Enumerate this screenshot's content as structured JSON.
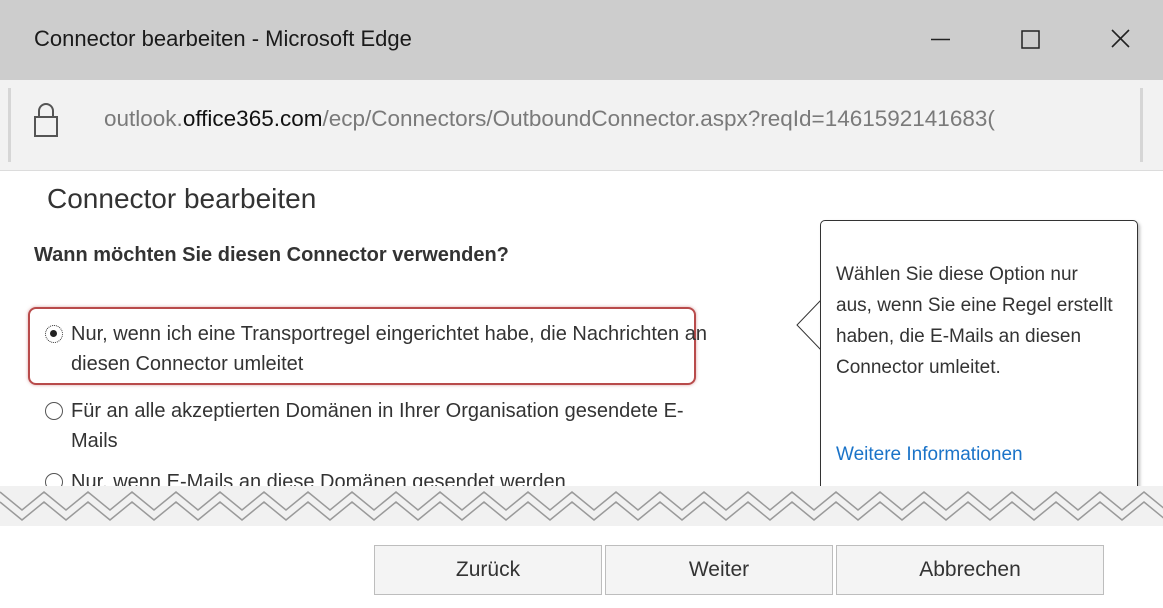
{
  "window": {
    "title": "Connector bearbeiten - Microsoft Edge"
  },
  "address_bar": {
    "url_prefix": "outlook.",
    "url_domain": "office365.com",
    "url_path": "/ecp/Connectors/OutboundConnector.aspx?reqId=1461592141683("
  },
  "page": {
    "title": "Connector bearbeiten",
    "question": "Wann möchten Sie diesen Connector verwenden?"
  },
  "options": [
    {
      "label": "Nur, wenn ich eine Transportregel eingerichtet habe, die Nachrichten an diesen Connector umleitet",
      "selected": true
    },
    {
      "label": "Für an alle akzeptierten Domänen in Ihrer Organisation gesendete E-Mails",
      "selected": false
    },
    {
      "label": "Nur, wenn E-Mails an diese Domänen gesendet werden",
      "selected": false
    }
  ],
  "callout": {
    "text": "Wählen Sie diese Option nur aus, wenn Sie eine Regel erstellt haben, die E-Mails an diesen Connector umleitet.",
    "link": "Weitere Informationen"
  },
  "buttons": {
    "back": "Zurück",
    "next": "Weiter",
    "cancel": "Abbrechen"
  },
  "colors": {
    "highlight": "#b84b4b",
    "link": "#1a73c8",
    "titlebar": "#cdcdcd"
  },
  "icons": [
    "lock-icon",
    "minimize-icon",
    "maximize-icon",
    "close-icon",
    "radio-selected-icon",
    "radio-unselected-icon"
  ]
}
